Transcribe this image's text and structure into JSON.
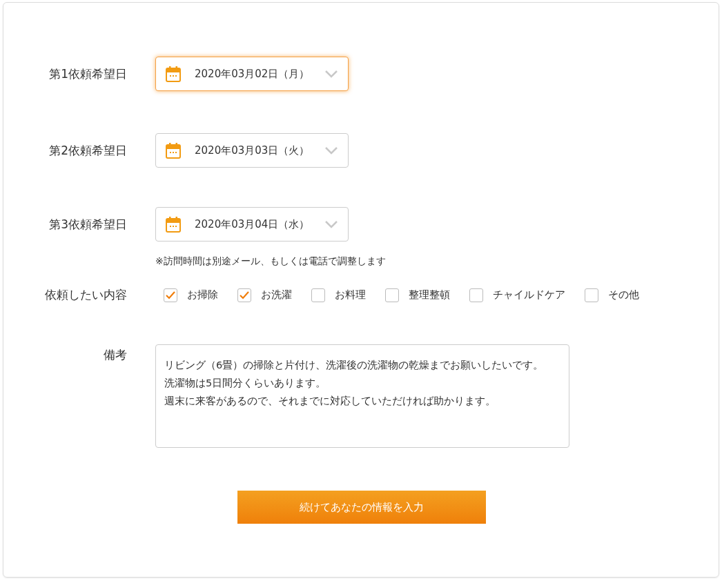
{
  "date_fields": [
    {
      "label": "第1依頼希望日",
      "value": "2020年03月02日（月）",
      "focused": true
    },
    {
      "label": "第2依頼希望日",
      "value": "2020年03月03日（火）",
      "focused": false
    },
    {
      "label": "第3依頼希望日",
      "value": "2020年03月04日（水）",
      "focused": false
    }
  ],
  "date_note": "※訪問時間は別途メール、もしくは電話で調整します",
  "services": {
    "label": "依頼したい内容",
    "options": [
      {
        "label": "お掃除",
        "checked": true
      },
      {
        "label": "お洗濯",
        "checked": true
      },
      {
        "label": "お料理",
        "checked": false
      },
      {
        "label": "整理整頓",
        "checked": false
      },
      {
        "label": "チャイルドケア",
        "checked": false
      },
      {
        "label": "その他",
        "checked": false
      }
    ]
  },
  "remarks": {
    "label": "備考",
    "lines": [
      "リビング（6畳）の掃除と片付け、洗濯後の洗濯物の乾燥までお願いしたいです。",
      "洗濯物は5日間分くらいあります。",
      "週末に来客があるので、それまでに対応していただければ助かります。"
    ]
  },
  "submit_button": "続けてあなたの情報を入力"
}
